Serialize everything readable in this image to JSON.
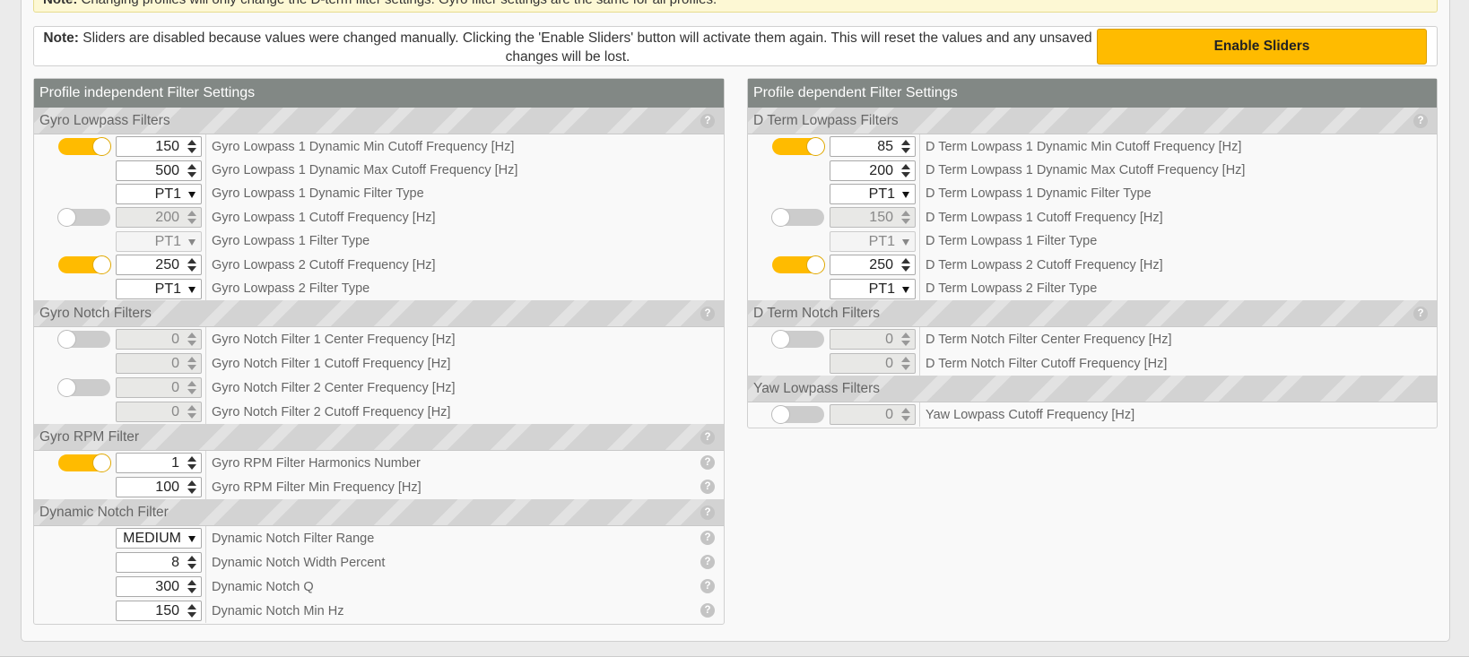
{
  "top_note": {
    "prefix": "Note:",
    "text": "Changing profiles will only change the D-term filter settings. Gyro filter settings are the same for all profiles."
  },
  "slider_note": {
    "prefix": "Note:",
    "text": "Sliders are disabled because values were changed manually. Clicking the 'Enable Sliders' button will activate them again. This will reset the values and any unsaved changes will be lost.",
    "button": "Enable Sliders"
  },
  "left": {
    "title": "Profile independent Filter Settings",
    "gyro_lowpass": {
      "title": "Gyro Lowpass Filters",
      "rows": [
        {
          "value": "150",
          "label": "Gyro Lowpass 1 Dynamic Min Cutoff Frequency [Hz]"
        },
        {
          "value": "500",
          "label": "Gyro Lowpass 1 Dynamic Max Cutoff Frequency [Hz]"
        },
        {
          "value": "PT1",
          "label": "Gyro Lowpass 1 Dynamic Filter Type"
        },
        {
          "value": "200",
          "label": "Gyro Lowpass 1 Cutoff Frequency [Hz]"
        },
        {
          "value": "PT1",
          "label": "Gyro Lowpass 1 Filter Type"
        },
        {
          "value": "250",
          "label": "Gyro Lowpass 2 Cutoff Frequency [Hz]"
        },
        {
          "value": "PT1",
          "label": "Gyro Lowpass 2 Filter Type"
        }
      ]
    },
    "gyro_notch": {
      "title": "Gyro Notch Filters",
      "rows": [
        {
          "value": "0",
          "label": "Gyro Notch Filter 1 Center Frequency [Hz]"
        },
        {
          "value": "0",
          "label": "Gyro Notch Filter 1 Cutoff Frequency [Hz]"
        },
        {
          "value": "0",
          "label": "Gyro Notch Filter 2 Center Frequency [Hz]"
        },
        {
          "value": "0",
          "label": "Gyro Notch Filter 2 Cutoff Frequency [Hz]"
        }
      ]
    },
    "gyro_rpm": {
      "title": "Gyro RPM Filter",
      "rows": [
        {
          "value": "1",
          "label": "Gyro RPM Filter Harmonics Number"
        },
        {
          "value": "100",
          "label": "Gyro RPM Filter Min Frequency [Hz]"
        }
      ]
    },
    "dyn_notch": {
      "title": "Dynamic Notch Filter",
      "rows": [
        {
          "value": "MEDIUM",
          "label": "Dynamic Notch Filter Range"
        },
        {
          "value": "8",
          "label": "Dynamic Notch Width Percent"
        },
        {
          "value": "300",
          "label": "Dynamic Notch Q"
        },
        {
          "value": "150",
          "label": "Dynamic Notch Min Hz"
        }
      ]
    }
  },
  "right": {
    "title": "Profile dependent Filter Settings",
    "dterm_lowpass": {
      "title": "D Term Lowpass Filters",
      "rows": [
        {
          "value": "85",
          "label": "D Term Lowpass 1 Dynamic Min Cutoff Frequency [Hz]"
        },
        {
          "value": "200",
          "label": "D Term Lowpass 1 Dynamic Max Cutoff Frequency [Hz]"
        },
        {
          "value": "PT1",
          "label": "D Term Lowpass 1 Dynamic Filter Type"
        },
        {
          "value": "150",
          "label": "D Term Lowpass 1 Cutoff Frequency [Hz]"
        },
        {
          "value": "PT1",
          "label": "D Term Lowpass 1 Filter Type"
        },
        {
          "value": "250",
          "label": "D Term Lowpass 2 Cutoff Frequency [Hz]"
        },
        {
          "value": "PT1",
          "label": "D Term Lowpass 2 Filter Type"
        }
      ]
    },
    "dterm_notch": {
      "title": "D Term Notch Filters",
      "rows": [
        {
          "value": "0",
          "label": "D Term Notch Filter Center Frequency [Hz]"
        },
        {
          "value": "0",
          "label": "D Term Notch Filter Cutoff Frequency [Hz]"
        }
      ]
    },
    "yaw_lowpass": {
      "title": "Yaw Lowpass Filters",
      "rows": [
        {
          "value": "0",
          "label": "Yaw Lowpass Cutoff Frequency [Hz]"
        }
      ]
    }
  },
  "help_glyph": "?",
  "colors": {
    "accent": "#ffbb00",
    "panel_header": "#828885",
    "note_bg": "#fdf8d4"
  }
}
